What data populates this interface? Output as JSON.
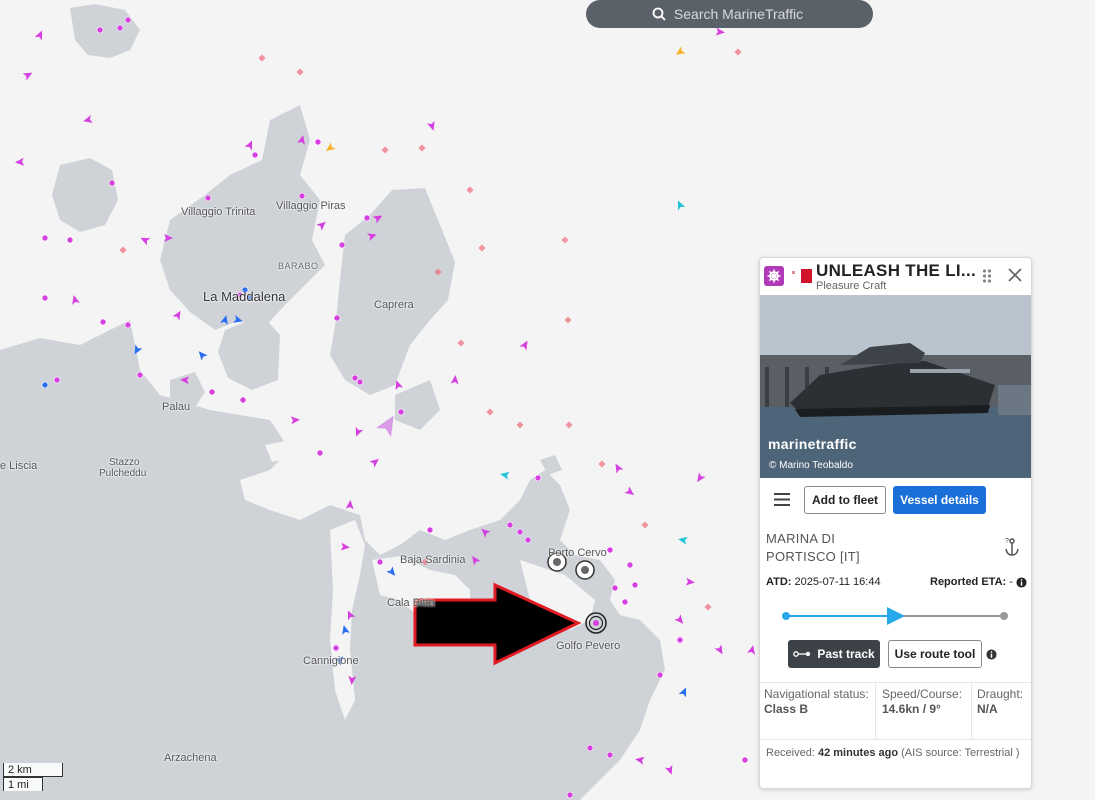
{
  "search": {
    "placeholder": "Search MarineTraffic",
    "icon": "search-icon"
  },
  "map": {
    "labels": {
      "la_maddalena": "La Maddalena",
      "villaggio_trinita": "Villaggio Trinita",
      "villaggio_piras": "Villaggio Piras",
      "barabo": "BARABO",
      "caprera": "Caprera",
      "palau": "Palau",
      "liscia": "e Liscia",
      "stazzo": "Stazzo",
      "pulcheddu": "Pulcheddu",
      "baja_sardinia": "Baja Sardinia",
      "porto_cervo": "Porto Cervo",
      "cala_bitta": "Cala Bitta",
      "golfo_pevero": "Golfo Pevero",
      "cannigione": "Cannigione",
      "arzachena": "Arzachena"
    },
    "scale": {
      "metric": "2 km",
      "imperial": "1 mi"
    },
    "colors": {
      "sea": "#f4f4f4",
      "land": "#cfd3d8",
      "pleasure": "#d640e0",
      "cargo": "#2a6df2",
      "passenger": "#25c3d6",
      "unknown": "#f06a7a"
    }
  },
  "vessel": {
    "name": "UNLEASH THE LI...",
    "type": "Pleasure Craft",
    "flag": "Malta",
    "photo_watermark": "marinetraffic",
    "photo_credit": "© Marino Teobaldo",
    "buttons": {
      "add_to_fleet": "Add to fleet",
      "vessel_details": "Vessel details",
      "past_track": "Past track",
      "route_tool": "Use route tool"
    },
    "port_line1": "MARINA DI",
    "port_line2": "PORTISCO [IT]",
    "atd_label": "ATD:",
    "atd_value": "2025-07-11 16:44",
    "eta_label": "Reported ETA:",
    "eta_value": "-",
    "progress": 0.5,
    "nav_status_label": "Navigational status:",
    "nav_status_value": "Class B",
    "speed_label": "Speed/Course:",
    "speed_value": "14.6kn / 9°",
    "draught_label": "Draught:",
    "draught_value": "N/A",
    "received_label": "Received:",
    "received_value": "42 minutes ago",
    "ais_source": "(AIS source: Terrestrial )"
  }
}
